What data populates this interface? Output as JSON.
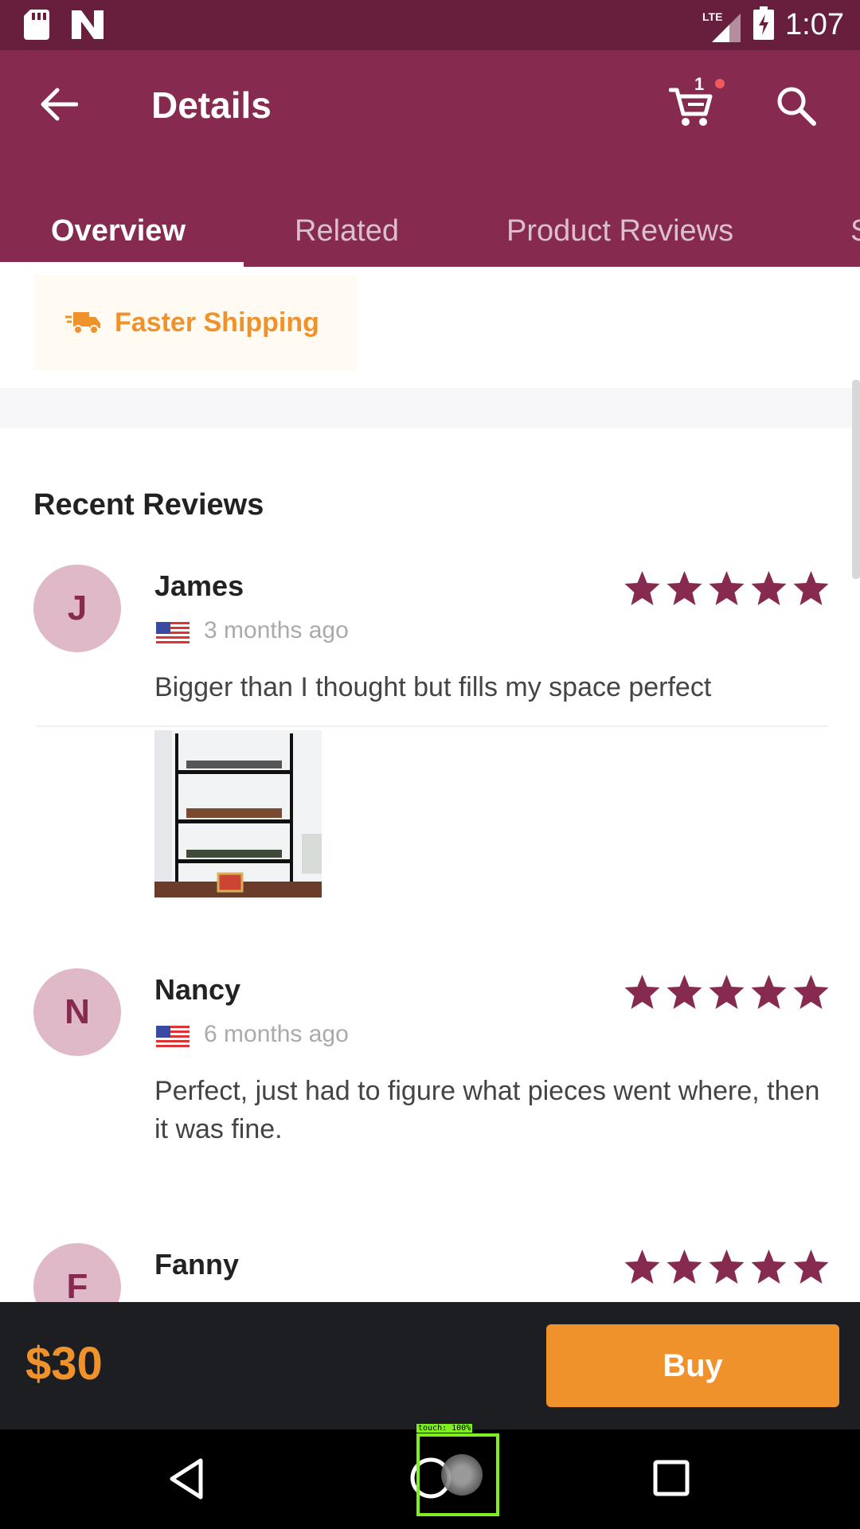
{
  "status_bar": {
    "time": "1:07",
    "network": "LTE",
    "icons": [
      "sd-card-icon",
      "n-logo-icon",
      "signal-icon",
      "battery-charging-icon"
    ]
  },
  "app_bar": {
    "title": "Details",
    "cart_count": "1",
    "icons": [
      "back-arrow-icon",
      "cart-icon",
      "search-icon"
    ]
  },
  "tabs": [
    {
      "label": "Overview",
      "active": true
    },
    {
      "label": "Related",
      "active": false
    },
    {
      "label": "Product Reviews",
      "active": false
    },
    {
      "label": "S",
      "active": false
    }
  ],
  "shipping": {
    "label": "Faster Shipping",
    "icon": "truck-icon"
  },
  "reviews_section": {
    "title": "Recent Reviews",
    "reviews": [
      {
        "initial": "J",
        "name": "James",
        "date": "3 months ago",
        "stars": 5,
        "text": "Bigger than I thought but fills my space perfect",
        "has_photo": true
      },
      {
        "initial": "N",
        "name": "Nancy",
        "date": "6 months ago",
        "stars": 5,
        "text": "Perfect, just had to figure what pieces went where, then it was fine.",
        "has_photo": false
      },
      {
        "initial": "F",
        "name": "Fanny",
        "date": "",
        "stars": 5,
        "text": "",
        "has_photo": false
      }
    ]
  },
  "buy_bar": {
    "price": "$30",
    "buy_label": "Buy"
  },
  "touch_overlay": {
    "label": "touch: 100%"
  },
  "colors": {
    "status_bar": "#671f3d",
    "app_bar": "#862b4f",
    "accent_orange": "#f0922c",
    "star": "#862b4f",
    "avatar_bg": "#dfb9c7"
  }
}
